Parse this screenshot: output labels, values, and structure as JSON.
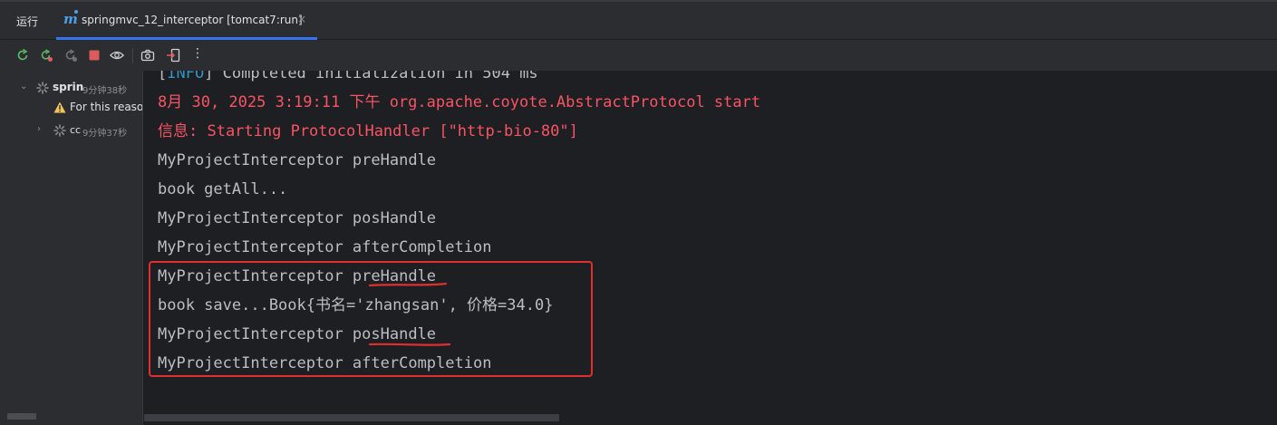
{
  "tabbar": {
    "run_label": "运行",
    "active_tab": {
      "icon": "maven-m-icon",
      "title": "springmvc_12_interceptor [tomcat7:run]",
      "close_glyph": "×"
    }
  },
  "toolbar": {
    "icons": [
      "rerun-icon",
      "rerun-failed-icon",
      "toggle-auto-test-icon",
      "stop-icon",
      "eye-icon",
      "camera-icon",
      "exit-icon",
      "more-icon"
    ],
    "more_glyph": "⋮"
  },
  "sidebar": {
    "items": [
      {
        "label": "sprin",
        "time": "9分钟38秒",
        "state": "running"
      },
      {
        "label": "For this reaso",
        "icon": "warning-icon"
      },
      {
        "label": "cc",
        "time": "9分钟37秒",
        "state": "running"
      }
    ]
  },
  "console": {
    "lines": [
      {
        "pre": "[",
        "info": "INFO",
        "post": "] Completed initialization in 504 ms"
      },
      {
        "text": "8月 30, 2025 3:19:11 下午 org.apache.coyote.AbstractProtocol start"
      },
      {
        "text": "信息: Starting ProtocolHandler [\"http-bio-80\"]"
      },
      {
        "text": "MyProjectInterceptor preHandle"
      },
      {
        "text": "book getAll..."
      },
      {
        "text": "MyProjectInterceptor posHandle"
      },
      {
        "text": "MyProjectInterceptor afterCompletion"
      },
      {
        "text": "MyProjectInterceptor preHandle"
      },
      {
        "text": "book save...Book{书名='zhangsan', 价格=34.0}"
      },
      {
        "text": "MyProjectInterceptor posHandle"
      },
      {
        "text": "MyProjectInterceptor afterCompletion"
      }
    ]
  },
  "colors": {
    "error_text": "#f75464",
    "info_tag": "#3592c4",
    "default_text": "#bcbec4",
    "annotation_red": "#e02f2f",
    "tab_underline": "#3574f0"
  }
}
